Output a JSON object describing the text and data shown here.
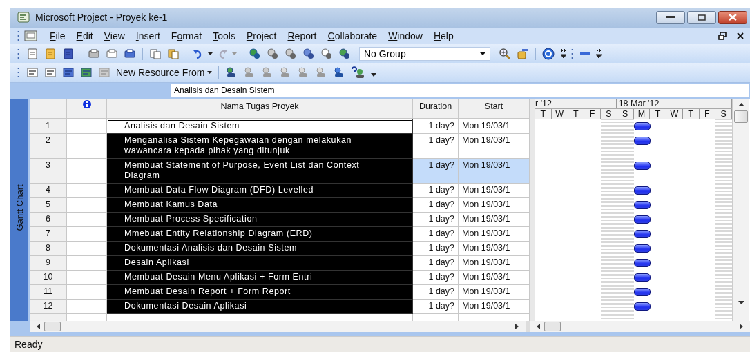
{
  "window": {
    "title": "Microsoft Project - Proyek ke-1"
  },
  "menu": [
    {
      "key": "F",
      "after": "ile"
    },
    {
      "key": "E",
      "after": "dit"
    },
    {
      "key": "V",
      "after": "iew"
    },
    {
      "key": "I",
      "after": "nsert"
    },
    {
      "before": "F",
      "key": "o",
      "after": "rmat"
    },
    {
      "key": "T",
      "after": "ools"
    },
    {
      "key": "P",
      "after": "roject"
    },
    {
      "key": "R",
      "after": "eport"
    },
    {
      "key": "C",
      "after": "ollaborate"
    },
    {
      "key": "W",
      "after": "indow"
    },
    {
      "key": "H",
      "after": "elp"
    }
  ],
  "toolbar": {
    "group_select": "No Group",
    "new_resource_from": {
      "before": "New Resource Fro",
      "key": "m"
    }
  },
  "entry_bar": {
    "value": "Analisis dan Desain Sistem"
  },
  "view_bar": {
    "label": "Gantt Chart"
  },
  "table": {
    "columns": [
      "Nama Tugas Proyek",
      "Duration",
      "Start"
    ],
    "rows": [
      {
        "id": "1",
        "name": "Analisis dan Desain Sistem",
        "duration": "1 day?",
        "start": "Mon 19/03/1",
        "selected": true,
        "active": true,
        "highlighted": false
      },
      {
        "id": "2",
        "name": "Menganalisa Sistem Kepegawaian dengan melakukan wawancara kepada pihak yang ditunjuk",
        "duration": "1 day?",
        "start": "Mon 19/03/1",
        "selected": true,
        "active": false,
        "highlighted": false
      },
      {
        "id": "3",
        "name": "Membuat Statement of Purpose, Event List dan Context Diagram",
        "duration": "1 day?",
        "start": "Mon 19/03/1",
        "selected": true,
        "active": false,
        "highlighted": true
      },
      {
        "id": "4",
        "name": "Membuat Data Flow Diagram (DFD) Levelled",
        "duration": "1 day?",
        "start": "Mon 19/03/1",
        "selected": true,
        "active": false,
        "highlighted": false
      },
      {
        "id": "5",
        "name": "Membuat Kamus Data",
        "duration": "1 day?",
        "start": "Mon 19/03/1",
        "selected": true,
        "active": false,
        "highlighted": false
      },
      {
        "id": "6",
        "name": "Membuat Process Specification",
        "duration": "1 day?",
        "start": "Mon 19/03/1",
        "selected": true,
        "active": false,
        "highlighted": false
      },
      {
        "id": "7",
        "name": "Mmebuat Entity Relationship Diagram (ERD)",
        "duration": "1 day?",
        "start": "Mon 19/03/1",
        "selected": true,
        "active": false,
        "highlighted": false
      },
      {
        "id": "8",
        "name": "Dokumentasi Analisis dan Desain Sistem",
        "duration": "1 day?",
        "start": "Mon 19/03/1",
        "selected": true,
        "active": false,
        "highlighted": false
      },
      {
        "id": "9",
        "name": "Desain Aplikasi",
        "duration": "1 day?",
        "start": "Mon 19/03/1",
        "selected": true,
        "active": false,
        "highlighted": false
      },
      {
        "id": "10",
        "name": "Membuat Desain Menu Aplikasi + Form Entri",
        "duration": "1 day?",
        "start": "Mon 19/03/1",
        "selected": true,
        "active": false,
        "highlighted": false
      },
      {
        "id": "11",
        "name": "Membuat Desain Report + Form Report",
        "duration": "1 day?",
        "start": "Mon 19/03/1",
        "selected": true,
        "active": false,
        "highlighted": false
      },
      {
        "id": "12",
        "name": "Dokumentasi Desain Aplikasi",
        "duration": "1 day?",
        "start": "Mon 19/03/1",
        "selected": true,
        "active": false,
        "highlighted": false
      }
    ]
  },
  "gantt": {
    "months": [
      {
        "label": "r '12",
        "days": [
          {
            "label": "T",
            "weekend": false
          },
          {
            "label": "W",
            "weekend": false
          },
          {
            "label": "T",
            "weekend": false
          },
          {
            "label": "F",
            "weekend": false
          },
          {
            "label": "S",
            "weekend": true
          }
        ]
      },
      {
        "label": "18 Mar '12",
        "days": [
          {
            "label": "S",
            "weekend": true
          },
          {
            "label": "M",
            "weekend": false
          },
          {
            "label": "T",
            "weekend": false
          },
          {
            "label": "W",
            "weekend": false
          },
          {
            "label": "T",
            "weekend": false
          },
          {
            "label": "F",
            "weekend": false
          },
          {
            "label": "S",
            "weekend": true
          }
        ]
      }
    ]
  },
  "status_bar": {
    "text": "Ready"
  }
}
